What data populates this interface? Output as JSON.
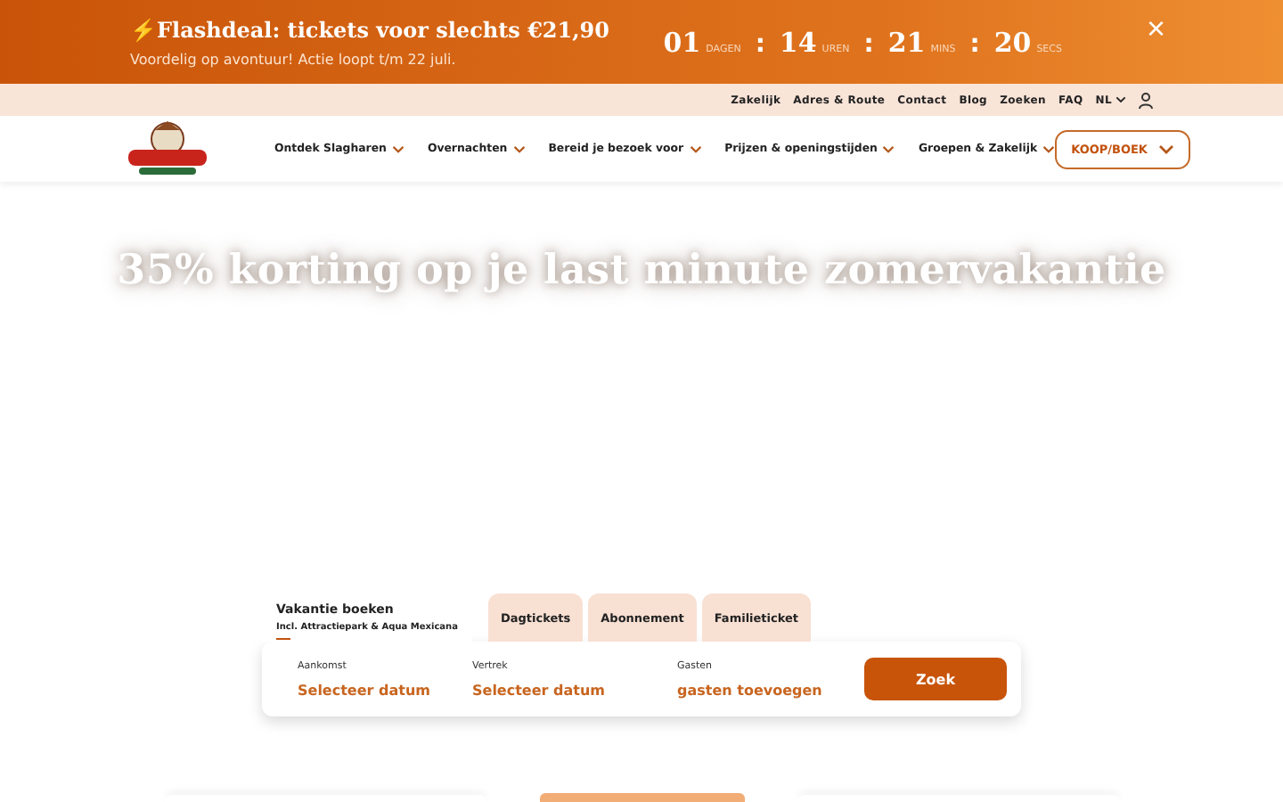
{
  "promo_banner": {
    "title": "⚡Flashdeal: tickets voor slechts €21,90",
    "subtitle": "Voordelig op avontuur! Actie loopt t/m 22 juli.",
    "countdown": [
      {
        "value": "01",
        "unit": "DAGEN"
      },
      {
        "value": "14",
        "unit": "UREN"
      },
      {
        "value": "21",
        "unit": "MINS"
      },
      {
        "value": "20",
        "unit": "SECS"
      }
    ],
    "separator": ":",
    "close": "×"
  },
  "top_links": [
    "Zakelijk",
    "Adres & Route",
    "Contact",
    "Blog",
    "Zoeken",
    "FAQ"
  ],
  "language": "NL",
  "nav": {
    "items": [
      "Ontdek Slagharen",
      "Overnachten",
      "Bereid je bezoek voor",
      "Prijzen & openingstijden",
      "Groepen & Zakelijk"
    ],
    "cta": "KOOP/BOEK"
  },
  "hero": {
    "heading": "35% korting op je last minute zomervakantie"
  },
  "booking": {
    "tabs": [
      {
        "label": "Vakantie boeken",
        "sublabel": "Incl. Attractiepark & Aqua Mexicana",
        "selected": true
      },
      {
        "label": "Dagtickets",
        "selected": false
      },
      {
        "label": "Abonnement",
        "selected": false
      },
      {
        "label": "Familieticket",
        "selected": false
      }
    ],
    "fields": [
      {
        "label": "Aankomst",
        "value": "Selecteer datum"
      },
      {
        "label": "Vertrek",
        "value": "Selecteer datum"
      },
      {
        "label": "Gasten",
        "value": "gasten toevoegen"
      }
    ],
    "button": "Zoek"
  }
}
